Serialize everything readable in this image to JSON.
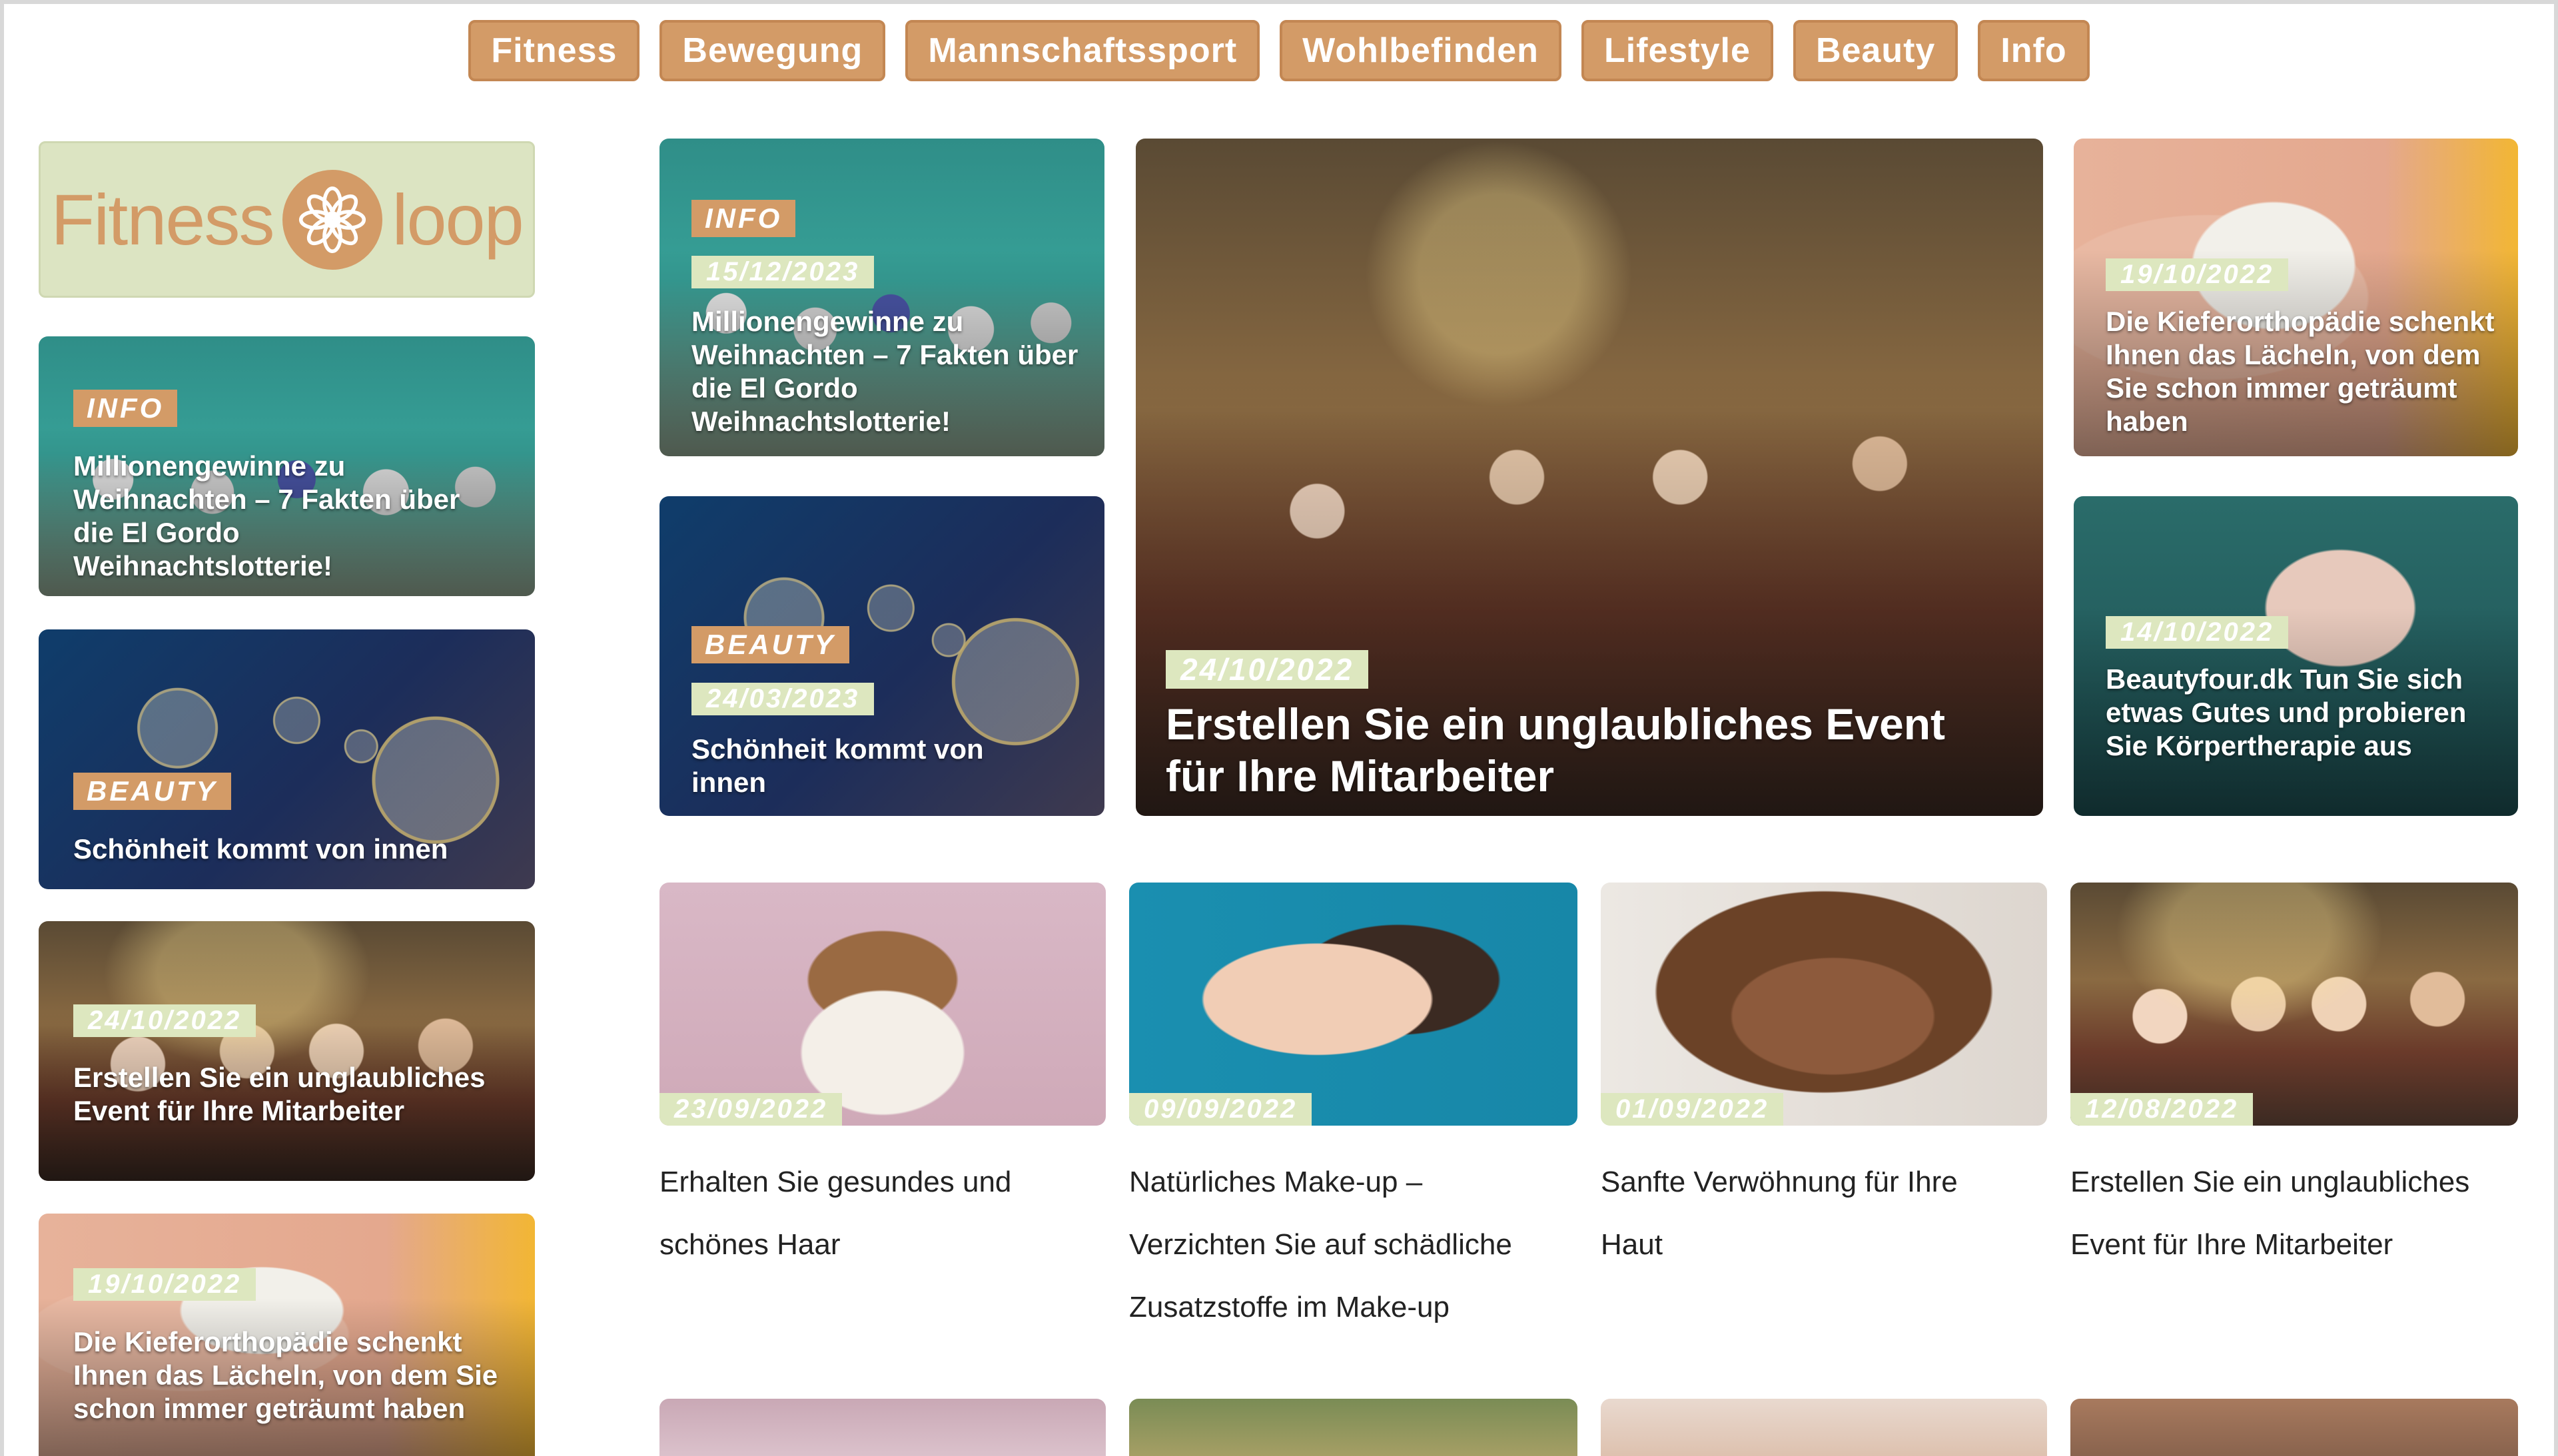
{
  "nav": [
    {
      "label": "Fitness"
    },
    {
      "label": "Bewegung"
    },
    {
      "label": "Mannschaftssport"
    },
    {
      "label": "Wohlbefinden"
    },
    {
      "label": "Lifestyle"
    },
    {
      "label": "Beauty"
    },
    {
      "label": "Info"
    }
  ],
  "logo": {
    "left": "Fitness",
    "right": "loop"
  },
  "sidebar": [
    {
      "tag": "INFO",
      "date": "",
      "title": "Millionengewinne zu Weihnachten – 7 Fakten über die El Gordo Weihnachtslotterie!"
    },
    {
      "tag": "BEAUTY",
      "date": "",
      "title": "Schönheit kommt von innen"
    },
    {
      "tag": "",
      "date": "24/10/2022",
      "title": "Erstellen Sie ein unglaubliches Event für Ihre Mitarbeiter"
    },
    {
      "tag": "",
      "date": "19/10/2022",
      "title": "Die Kieferorthopädie schenkt Ihnen das Lächeln, von dem Sie schon immer geträumt haben"
    }
  ],
  "featured": [
    {
      "tag": "INFO",
      "date": "15/12/2023",
      "title": "Millionengewinne zu Weihnachten – 7 Fakten über die El Gordo Weihnachtslotterie!"
    },
    {
      "tag": "BEAUTY",
      "date": "24/03/2023",
      "title": "Schönheit kommt von innen"
    },
    {
      "tag": "",
      "date": "24/10/2022",
      "title": "Erstellen Sie ein unglaubliches Event für Ihre Mitarbeiter"
    },
    {
      "tag": "",
      "date": "19/10/2022",
      "title": "Die Kieferorthopädie schenkt Ihnen das Lächeln, von dem Sie schon immer geträumt haben"
    },
    {
      "tag": "",
      "date": "14/10/2022",
      "title": "Beautyfour.dk Tun Sie sich etwas Gutes und probieren Sie Körpertherapie aus"
    }
  ],
  "grid": [
    {
      "date": "23/09/2022",
      "title": "Erhalten Sie gesundes und schönes Haar"
    },
    {
      "date": "09/09/2022",
      "title": "Natürliches Make-up – Verzichten Sie auf schädliche Zusatzstoffe im Make-up"
    },
    {
      "date": "01/09/2022",
      "title": "Sanfte Verwöhnung für Ihre Haut"
    },
    {
      "date": "12/08/2022",
      "title": "Erstellen Sie ein unglaubliches Event für Ihre Mitarbeiter"
    }
  ],
  "colors": {
    "accent": "#d39b67",
    "date_bg": "#dde7bf",
    "logo_bg": "#dce4c2"
  }
}
